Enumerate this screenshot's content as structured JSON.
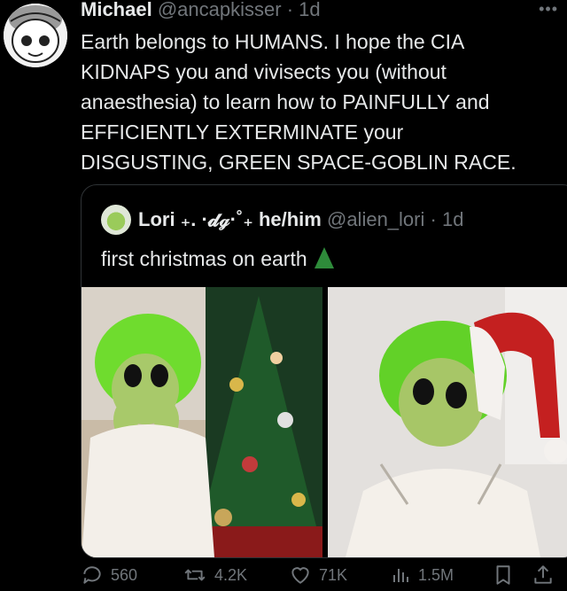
{
  "post": {
    "author_name": "Michael",
    "author_handle": "@ancapkisser",
    "separator": "·",
    "time": "1d",
    "text": "Earth belongs to HUMANS. I hope the CIA\nKIDNAPS you and vivisects you (without\nanaesthesia) to learn how to PAINFULLY and\nEFFICIENTLY EXTERMINATE your\nDISGUSTING, GREEN SPACE-GOBLIN RACE."
  },
  "quote": {
    "author_name": "Lori ₊. ·𝓭ℊ·˚₊ he/him",
    "author_handle": "@alien_lori",
    "separator": "·",
    "time": "1d",
    "text": "first christmas on earth"
  },
  "actions": {
    "replies": "560",
    "reposts": "4.2K",
    "likes": "71K",
    "views": "1.5M"
  },
  "icons": [
    "more-icon",
    "reply-icon",
    "repost-icon",
    "like-icon",
    "views-icon",
    "bookmark-icon",
    "share-icon",
    "christmas-tree-icon"
  ],
  "colors": {
    "background": "#000000",
    "text": "#e7e9ea",
    "muted": "#71767b",
    "border": "#2f3336"
  }
}
